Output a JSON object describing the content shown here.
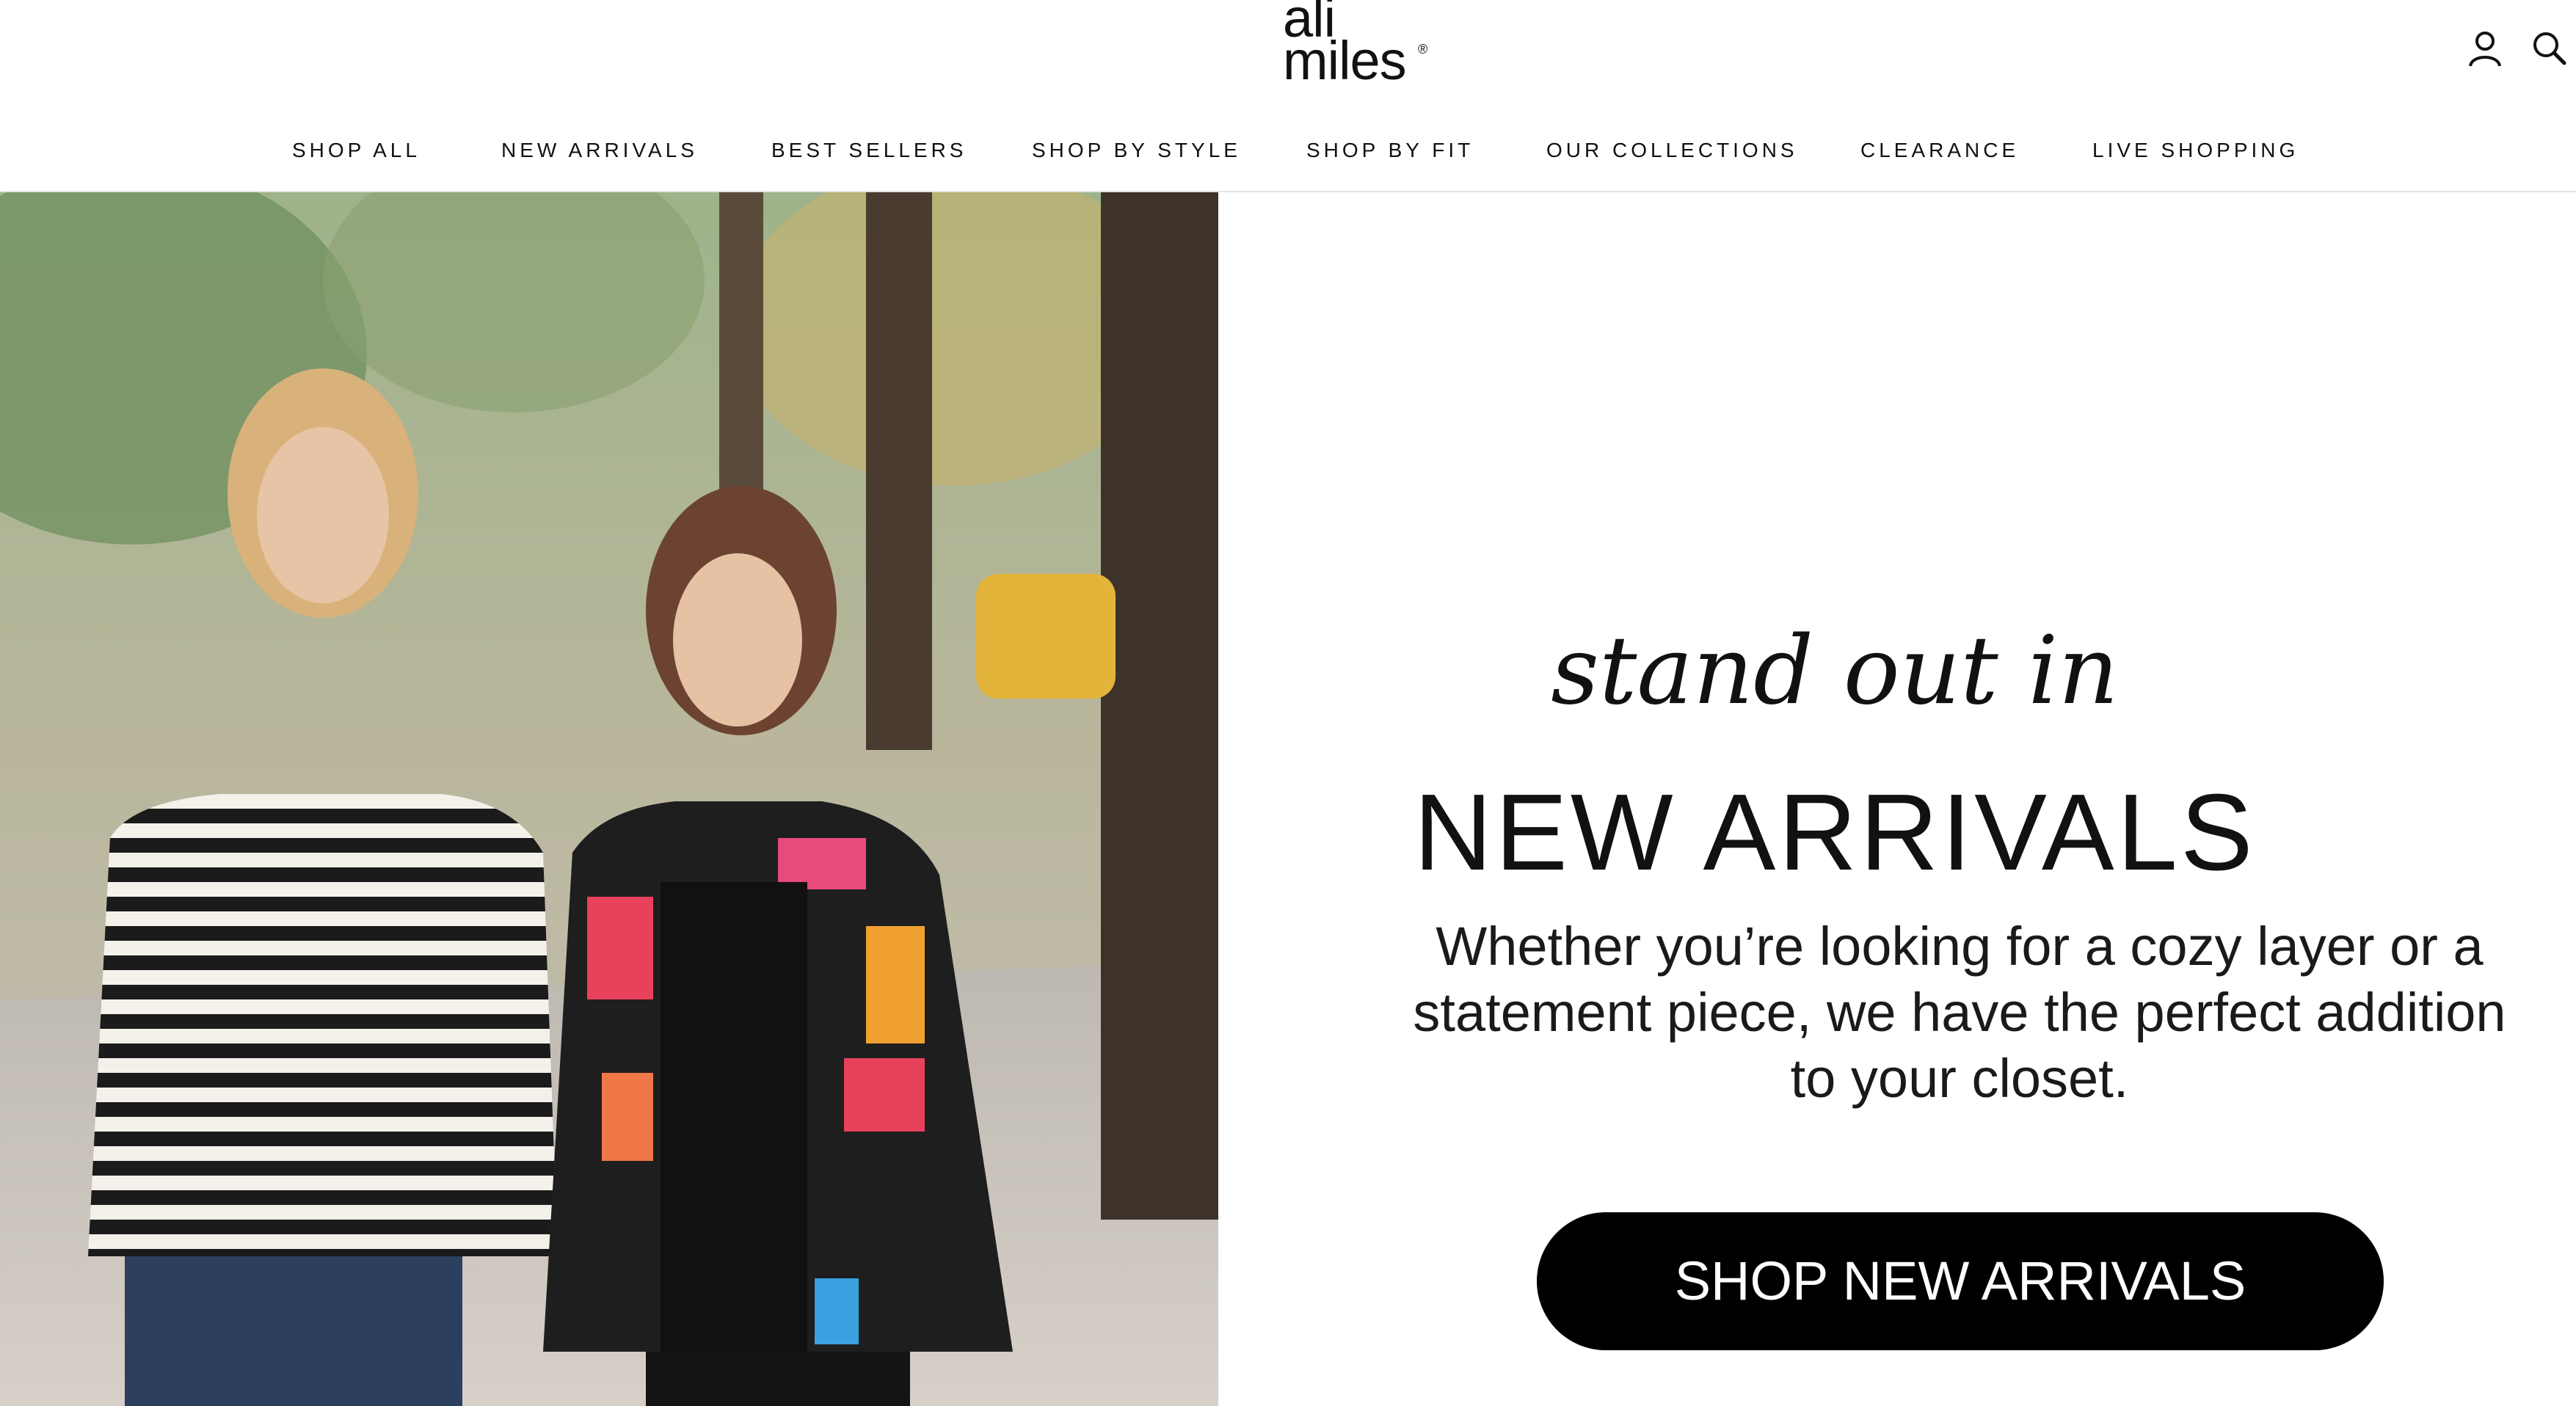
{
  "brand": {
    "line1": "ali",
    "line2": "miles",
    "mark": "®"
  },
  "header_icons": [
    "account-icon",
    "search-icon"
  ],
  "nav": [
    {
      "label": "SHOP ALL"
    },
    {
      "label": "NEW ARRIVALS"
    },
    {
      "label": "BEST SELLERS"
    },
    {
      "label": "SHOP BY STYLE"
    },
    {
      "label": "SHOP BY FIT"
    },
    {
      "label": "OUR COLLECTIONS"
    },
    {
      "label": "CLEARANCE"
    },
    {
      "label": "LIVE SHOPPING"
    }
  ],
  "promo": {
    "script": "stand out in",
    "title": "NEW ARRIVALS",
    "body": "Whether you’re looking for a cozy layer or a statement piece, we have the perfect addition to your closet.",
    "cta": "SHOP NEW ARRIVALS"
  },
  "colors": {
    "cta_bg": "#000000",
    "cta_text": "#ffffff",
    "nav_text": "#111111"
  }
}
